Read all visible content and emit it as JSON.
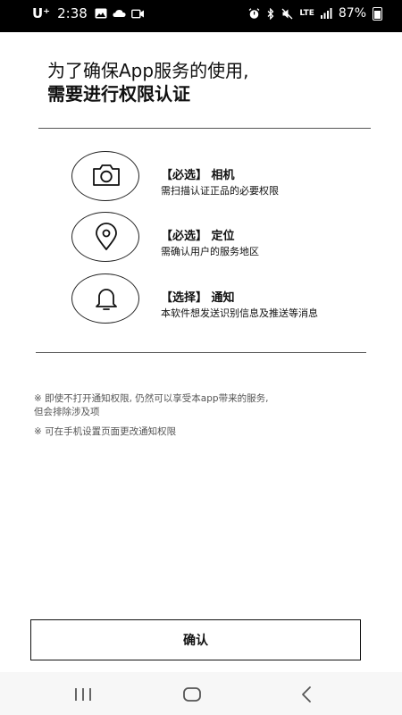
{
  "status_bar": {
    "carrier": "U⁺",
    "time": "2:38",
    "lte": "LTE",
    "battery": "87%"
  },
  "heading": {
    "line1": "为了确保App服务的使用,",
    "line2": "需要进行权限认证"
  },
  "permissions": [
    {
      "icon": "camera-icon",
      "title": "【必选】 相机",
      "description": "需扫描认证正品的必要权限"
    },
    {
      "icon": "location-pin-icon",
      "title": "【必选】 定位",
      "description": "需确认用户的服务地区"
    },
    {
      "icon": "bell-icon",
      "title": "【选择】 通知",
      "description": "本软件想发送识别信息及推送等消息"
    }
  ],
  "notes": [
    "※ 即使不打开通知权限, 仍然可以享受本app带来的服务,",
    "但会排除涉及项",
    "※ 可在手机设置页面更改通知权限"
  ],
  "confirm_label": "确认"
}
